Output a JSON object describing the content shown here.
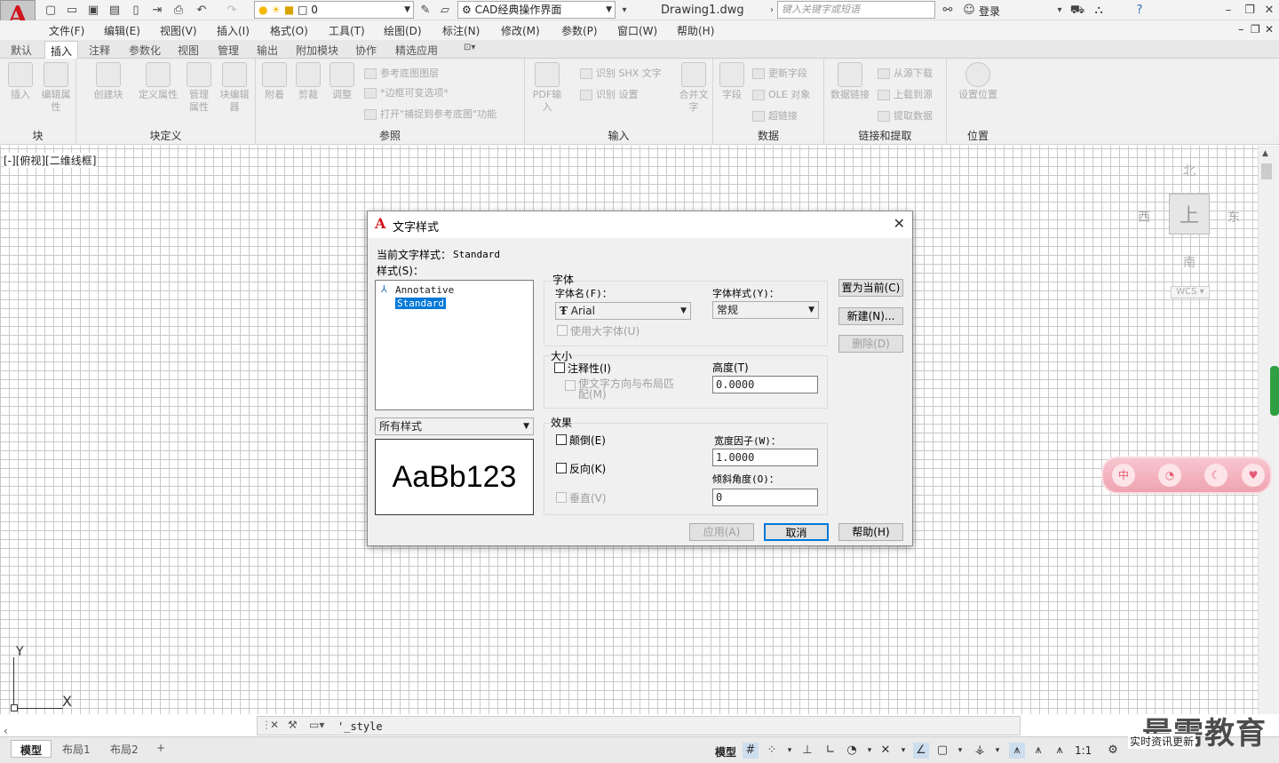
{
  "titlebar": {
    "workspace": "CAD经典操作界面",
    "layer_value": "0",
    "document_title": "Drawing1.dwg",
    "search_placeholder": "键入关键字或短语",
    "login": "登录"
  },
  "menubar": {
    "items": [
      "文件(F)",
      "编辑(E)",
      "视图(V)",
      "插入(I)",
      "格式(O)",
      "工具(T)",
      "绘图(D)",
      "标注(N)",
      "修改(M)",
      "参数(P)",
      "窗口(W)",
      "帮助(H)"
    ]
  },
  "ribbon_tabs": [
    "默认",
    "插入",
    "注释",
    "参数化",
    "视图",
    "管理",
    "输出",
    "附加模块",
    "协作",
    "精选应用"
  ],
  "ribbon": {
    "block": {
      "title": "块",
      "insert": "插入",
      "edit_attr": "编辑属性"
    },
    "block_def": {
      "title": "块定义",
      "create": "创建块",
      "define_attr": "定义属性",
      "manage_attr": "管理属性",
      "block_editor": "块编辑器"
    },
    "reference": {
      "title": "参照",
      "attach": "附着",
      "clip": "剪裁",
      "adjust": "调整",
      "underlay_layers": "参考底图图层",
      "frames": "*边框可变选项*",
      "snap": "打开\"捕捉到参考底图\"功能"
    },
    "import": {
      "title": "输入",
      "pdf_import": "PDF输入",
      "recognize_shx": "识别 SHX 文字",
      "recognize_settings": "识别 设置",
      "combine_text": "合并文字"
    },
    "data": {
      "title": "数据",
      "field": "字段",
      "update_fields": "更新字段",
      "ole_object": "OLE 对象",
      "hyperlink": "超链接"
    },
    "linking": {
      "title": "链接和提取",
      "data_link": "数据链接",
      "download_source": "从源下载",
      "upload_source": "上载到源",
      "extract_data": "提取数据"
    },
    "location": {
      "title": "位置",
      "set_location": "设置位置"
    }
  },
  "viewport": {
    "label": "[-][俯视][二维线框]",
    "compass": {
      "north": "北",
      "south": "南",
      "east": "东",
      "west": "西",
      "top": "上"
    },
    "wcs": "WCS",
    "ucs_x": "X",
    "ucs_y": "Y"
  },
  "dialog": {
    "title": "文字样式",
    "current_style_label": "当前文字样式：",
    "current_style_value": "Standard",
    "styles_label": "样式(S)：",
    "styles": [
      "Annotative",
      "Standard"
    ],
    "selected_style": "Standard",
    "filter_value": "所有样式",
    "preview_text": "AaBb123",
    "font_group": "字体",
    "font_name_label": "字体名(F)：",
    "font_name_value": "Arial",
    "font_style_label": "字体样式(Y)：",
    "font_style_value": "常规",
    "use_bigfont": "使用大字体(U)",
    "size_group": "大小",
    "annotative": "注释性(I)",
    "match_orientation": "使文字方向与布局匹配(M)",
    "height_label": "高度(T)",
    "height_value": "0.0000",
    "effects_group": "效果",
    "upside_down": "颠倒(E)",
    "backwards": "反向(K)",
    "vertical": "垂直(V)",
    "width_factor_label": "宽度因子(W)：",
    "width_factor_value": "1.0000",
    "oblique_label": "倾斜角度(O)：",
    "oblique_value": "0",
    "set_current": "置为当前(C)",
    "new": "新建(N)...",
    "delete": "删除(D)",
    "apply": "应用(A)",
    "cancel": "取消",
    "help": "帮助(H)"
  },
  "command": {
    "text": "'_style"
  },
  "statusbar": {
    "tabs": [
      "模型",
      "布局1",
      "布局2"
    ],
    "model_label": "模型",
    "scale": "1:1"
  },
  "overlay": {
    "watermark": "最需教育",
    "news": "实时资讯更新"
  }
}
